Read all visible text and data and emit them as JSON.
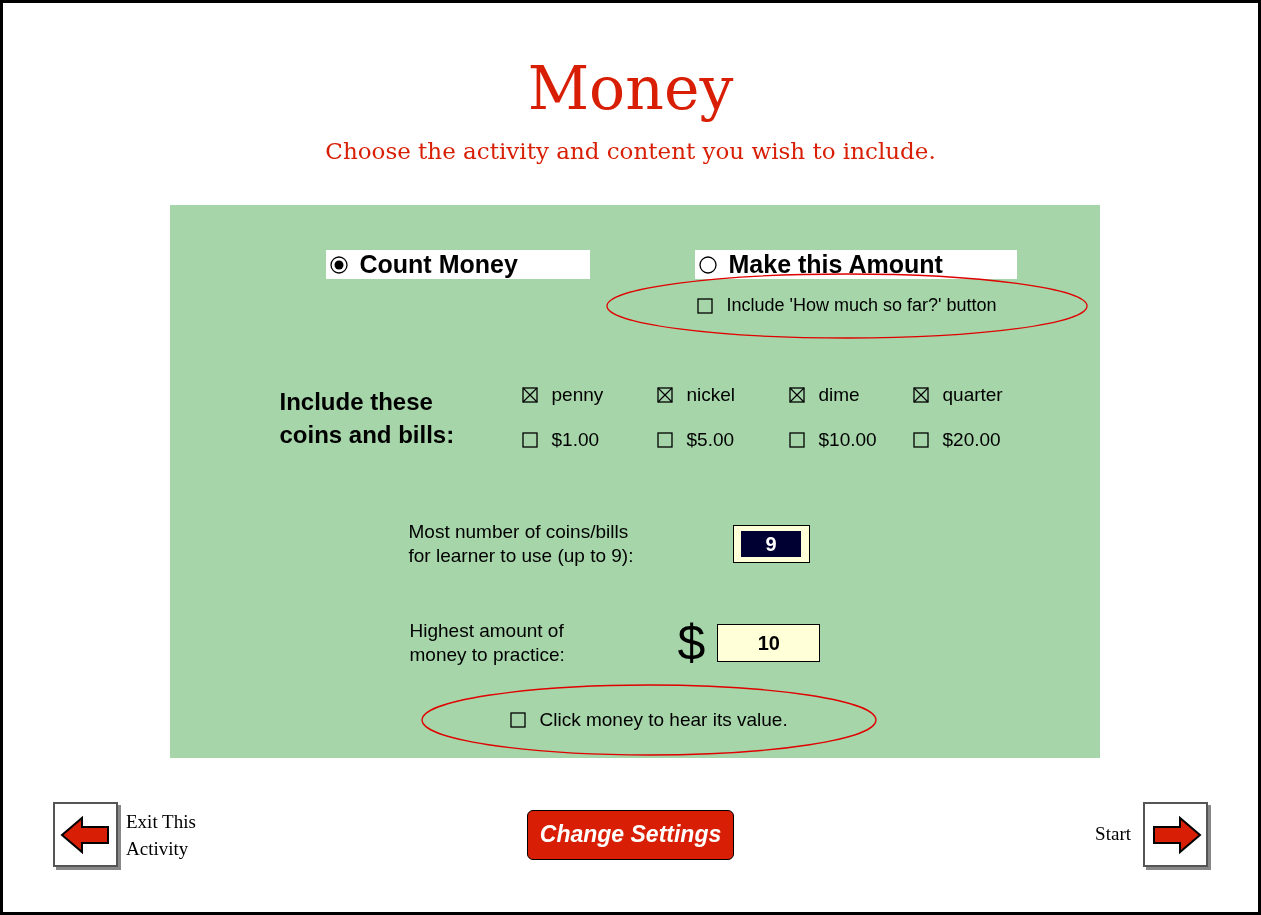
{
  "title": "Money",
  "subtitle": "Choose the activity and content you wish to include.",
  "activities": [
    {
      "label": "Count Money",
      "selected": true
    },
    {
      "label": "Make this Amount",
      "selected": false
    }
  ],
  "how_much_option": {
    "label": "Include 'How much so far?' button",
    "checked": false,
    "circled": true
  },
  "coins_label": "Include these coins and bills:",
  "coins": [
    {
      "label": "penny",
      "checked": true
    },
    {
      "label": "nickel",
      "checked": true
    },
    {
      "label": "dime",
      "checked": true
    },
    {
      "label": "quarter",
      "checked": true
    },
    {
      "label": "$1.00",
      "checked": false
    },
    {
      "label": "$5.00",
      "checked": false
    },
    {
      "label": "$10.00",
      "checked": false
    },
    {
      "label": "$20.00",
      "checked": false
    }
  ],
  "max_count": {
    "label_lines": [
      "Most number of coins/bills",
      "for learner to use (up to 9):"
    ],
    "value": "9",
    "highlighted": true
  },
  "max_amount": {
    "label_lines": [
      "Highest amount of",
      "money to practice:"
    ],
    "currency": "$",
    "value": "10"
  },
  "hear_value": {
    "label": "Click money to hear its value.",
    "checked": false,
    "circled": true
  },
  "exit_button": {
    "label_lines": [
      "Exit This",
      "Activity"
    ]
  },
  "change_settings": "Change Settings",
  "start_button": {
    "label": "Start"
  }
}
